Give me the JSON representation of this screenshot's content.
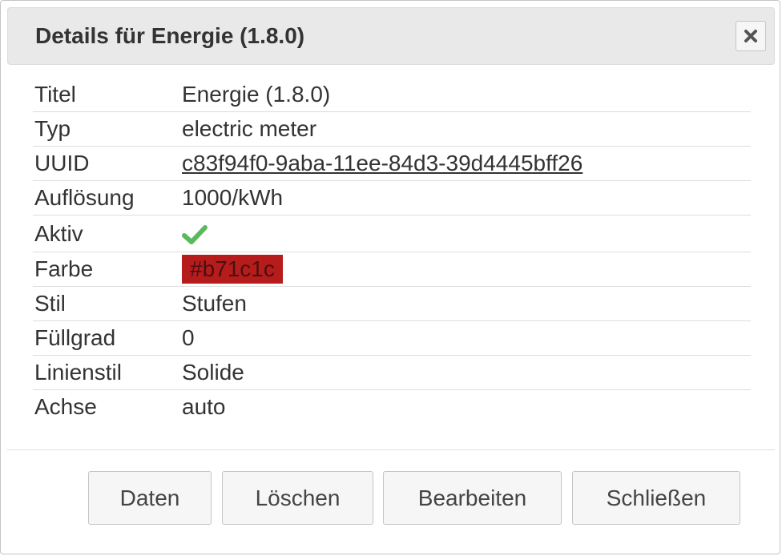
{
  "dialog": {
    "title": "Details für Energie (1.8.0)",
    "close_icon": "close-icon"
  },
  "details": {
    "rows": [
      {
        "key": "Titel",
        "value": "Energie (1.8.0)"
      },
      {
        "key": "Typ",
        "value": "electric meter"
      },
      {
        "key": "UUID",
        "value": "c83f94f0-9aba-11ee-84d3-39d4445bff26"
      },
      {
        "key": "Auflösung",
        "value": "1000/kWh"
      },
      {
        "key": "Aktiv",
        "value_icon": "checkmark-icon",
        "checked": true
      },
      {
        "key": "Farbe",
        "value": "#b71c1c"
      },
      {
        "key": "Stil",
        "value": "Stufen"
      },
      {
        "key": "Füllgrad",
        "value": "0"
      },
      {
        "key": "Linienstil",
        "value": "Solide"
      },
      {
        "key": "Achse",
        "value": "auto"
      }
    ]
  },
  "buttons": {
    "data_label": "Daten",
    "delete_label": "Löschen",
    "edit_label": "Bearbeiten",
    "close_label": "Schließen"
  },
  "colors": {
    "swatch": "#b71c1c",
    "check": "#5cb85c"
  }
}
